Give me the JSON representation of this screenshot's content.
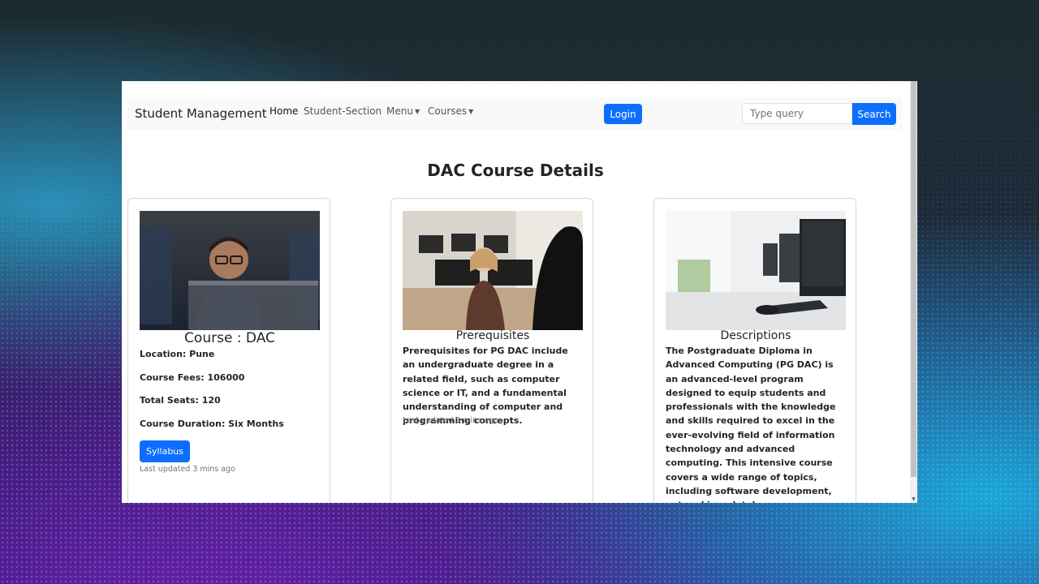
{
  "navbar": {
    "brand": "Student Management",
    "links": [
      "Home",
      "Student-Section",
      "Menu",
      "Courses"
    ],
    "login_label": "Login",
    "search_placeholder": "Type query",
    "search_label": "Search"
  },
  "main": {
    "title": "DAC Course Details",
    "cards": [
      {
        "title": "Course : DAC",
        "location": "Location: Pune",
        "fees": "Course Fees: 106000",
        "seats": "Total Seats: 120",
        "duration": "Course Duration: Six Months",
        "button": "Syllabus",
        "updated": "Last updated 3 mins ago"
      },
      {
        "title": "Prerequisites",
        "text": "Prerequisites for PG DAC include an undergraduate degree in a related field, such as computer science or IT, and a fundamental understanding of computer and programming concepts.",
        "updated": "Last updated 3 mins ago"
      },
      {
        "title": "Descriptions",
        "text": "The Postgraduate Diploma in Advanced Computing (PG DAC) is an advanced-level program designed to equip students and professionals with the knowledge and skills required to excel in the ever-evolving field of information technology and advanced computing. This intensive course covers a wide range of topics, including software development, networking, database management, and cybersecurity."
      }
    ]
  },
  "colors": {
    "primary": "#0d6efd",
    "navbar_bg": "#f8f9fa"
  }
}
